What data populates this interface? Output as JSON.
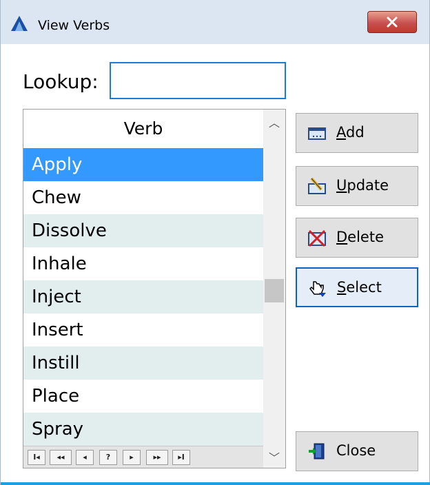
{
  "window": {
    "title": "View Verbs"
  },
  "lookup": {
    "label": "Lookup:",
    "value": ""
  },
  "grid": {
    "column_header": "Verb",
    "rows": [
      {
        "verb": "Apply",
        "selected": true
      },
      {
        "verb": "Chew"
      },
      {
        "verb": "Dissolve"
      },
      {
        "verb": "Inhale"
      },
      {
        "verb": "Inject"
      },
      {
        "verb": "Insert"
      },
      {
        "verb": "Instill"
      },
      {
        "verb": "Place"
      },
      {
        "verb": "Spray"
      }
    ],
    "navigator": [
      "I◂",
      "◂◂",
      "◂",
      "?",
      "▸",
      "▸▸",
      "▸I"
    ]
  },
  "buttons": {
    "add": {
      "mnemonic": "A",
      "rest": "dd",
      "icon": "add-form-icon"
    },
    "update": {
      "mnemonic": "U",
      "rest": "pdate",
      "icon": "edit-pencil-icon"
    },
    "delete": {
      "mnemonic": "D",
      "rest": "elete",
      "icon": "delete-x-icon"
    },
    "select": {
      "mnemonic": "S",
      "rest": "elect",
      "icon": "hand-pointer-icon"
    },
    "close": {
      "label": "Close",
      "icon": "exit-door-icon"
    }
  },
  "colors": {
    "selection": "#3399ff",
    "alt_row": "#e2eeee",
    "titlebar": "#dce6f2",
    "focus_border": "#1e7ad6"
  }
}
